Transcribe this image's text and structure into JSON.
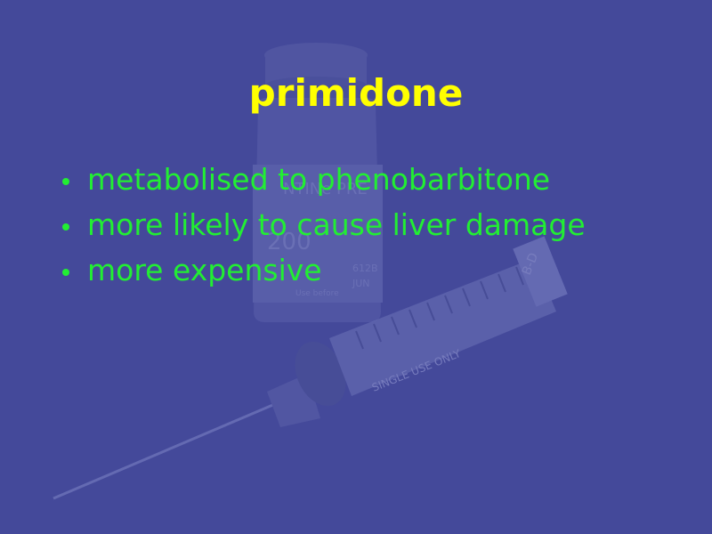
{
  "slide": {
    "title": "primidone",
    "bullets": [
      "metabolised to phenobarbitone",
      "more likely to cause liver damage",
      "more expensive"
    ]
  },
  "background_image": {
    "vial_label_lines": [
      "NTINe PRE",
      "200",
      "612B",
      "JUN",
      "Use before"
    ],
    "syringe_text": "SINGLE USE ONLY",
    "syringe_brand": "B-D"
  },
  "colors": {
    "background": "#44499a",
    "title": "#ffff00",
    "bullets": "#22ee33"
  }
}
